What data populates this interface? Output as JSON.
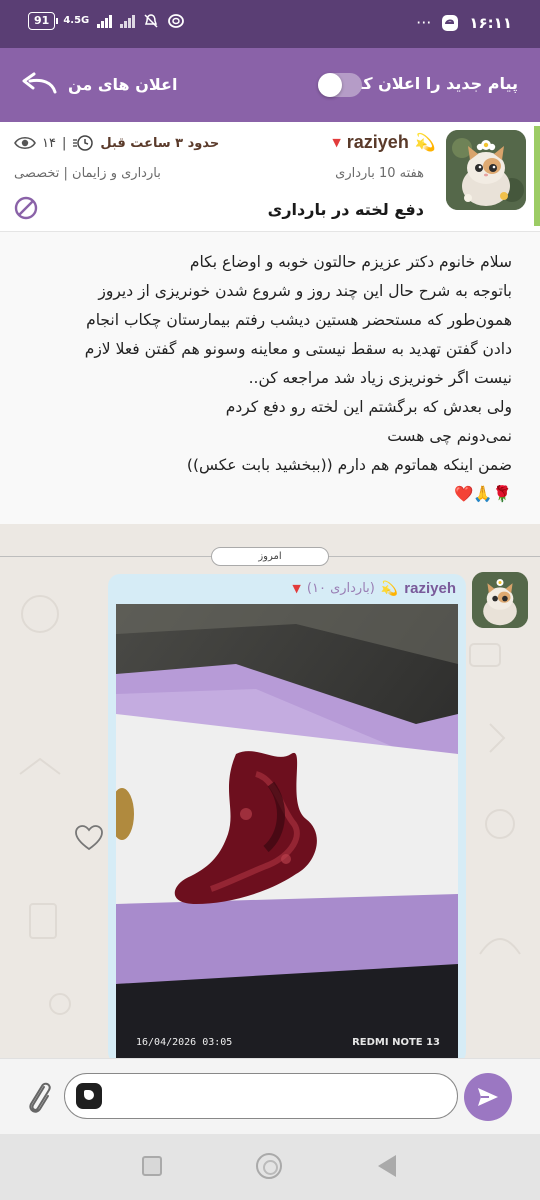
{
  "status_bar": {
    "time": "۱۶:۱۱",
    "battery": "91",
    "network": "4.5G",
    "more": "···"
  },
  "header": {
    "title": "پیام جدید را اعلان کن",
    "toggle_on": false,
    "notifications_label": "اعلان های من"
  },
  "post": {
    "username": "raziyeh",
    "week": "هفته 10 بارداری",
    "title": "دفع لخته در بارداری",
    "time_ago": "حدود ۳ ساعت قبل",
    "views": "۱۴",
    "separator": "|",
    "category": "بارداری و زایمان | تخصصی",
    "body_lines": [
      "سلام خانوم دکتر عزیزم حالتون خوبه و اوضاع بکام",
      "باتوجه به شرح حال این چند روز و شروع شدن خونریزی از دیروز",
      "همون‌طور که مستحضر هستین دیشب رفتم بیمارستان چکاب انجام",
      "دادن گفتن تهدید به سقط نیستی و معاینه وسونو هم گفتن فعلا لازم",
      "نیست اگر خونریزی زیاد شد مراجعه کن..",
      "ولی بعدش که برگشتم این لخته رو دفع کردم",
      "نمی‌دونم چی هست",
      "ضمن اینکه هماتوم هم دارم ((ببخشید بابت عکس))",
      "🌹🙏❤️"
    ]
  },
  "chat": {
    "date_label": "امروز",
    "message": {
      "username": "raziyeh",
      "week": "(۱۰ بارداری)",
      "photo_timestamp": "16/04/2026 03:05",
      "photo_brand": "REDMI NOTE 13"
    }
  },
  "composer": {
    "value": "",
    "placeholder": ""
  },
  "colors": {
    "status_bar": "#5a3e74",
    "header": "#8a62a8",
    "accent_green": "#9ccc65",
    "bubble": "#d6ecf6",
    "send_button": "#9b77c2"
  }
}
